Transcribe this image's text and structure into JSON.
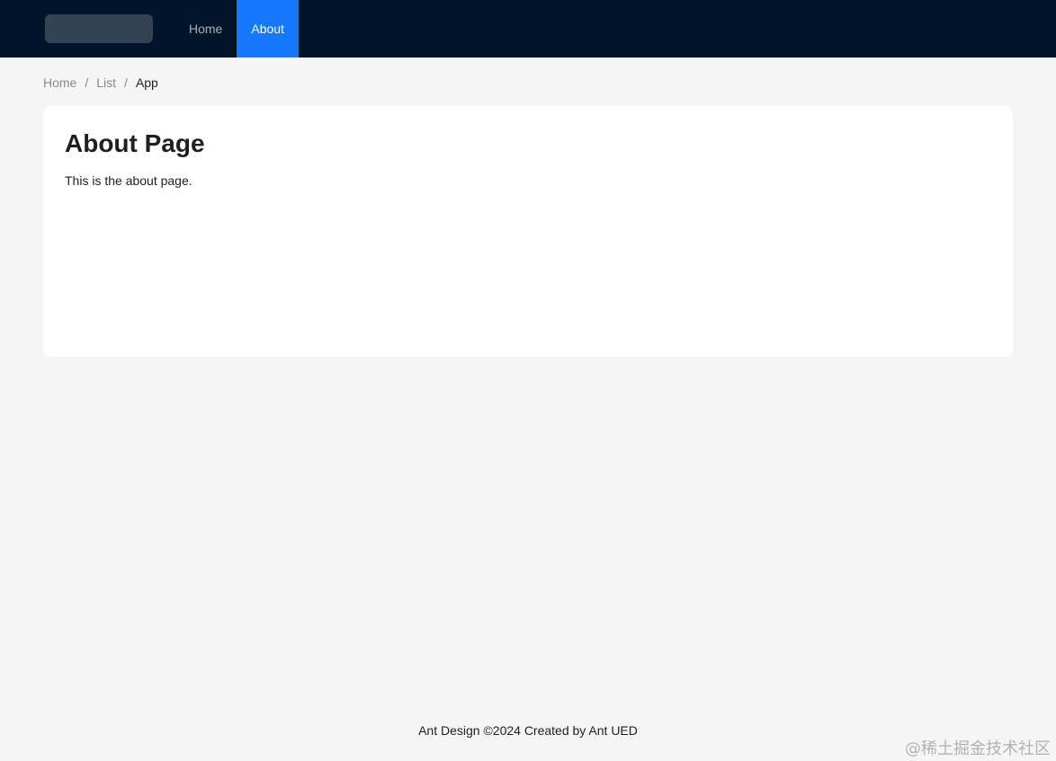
{
  "header": {
    "menu": [
      {
        "label": "Home",
        "active": false
      },
      {
        "label": "About",
        "active": true
      }
    ],
    "colors": {
      "background": "#001529",
      "active": "#1677ff"
    }
  },
  "breadcrumb": {
    "items": [
      "Home",
      "List",
      "App"
    ],
    "separator": "/"
  },
  "card": {
    "title": "About Page",
    "body": "This is the about page."
  },
  "footer": {
    "text": "Ant Design ©2024 Created by Ant UED"
  },
  "watermark": {
    "text": "@稀土掘金技术社区"
  }
}
